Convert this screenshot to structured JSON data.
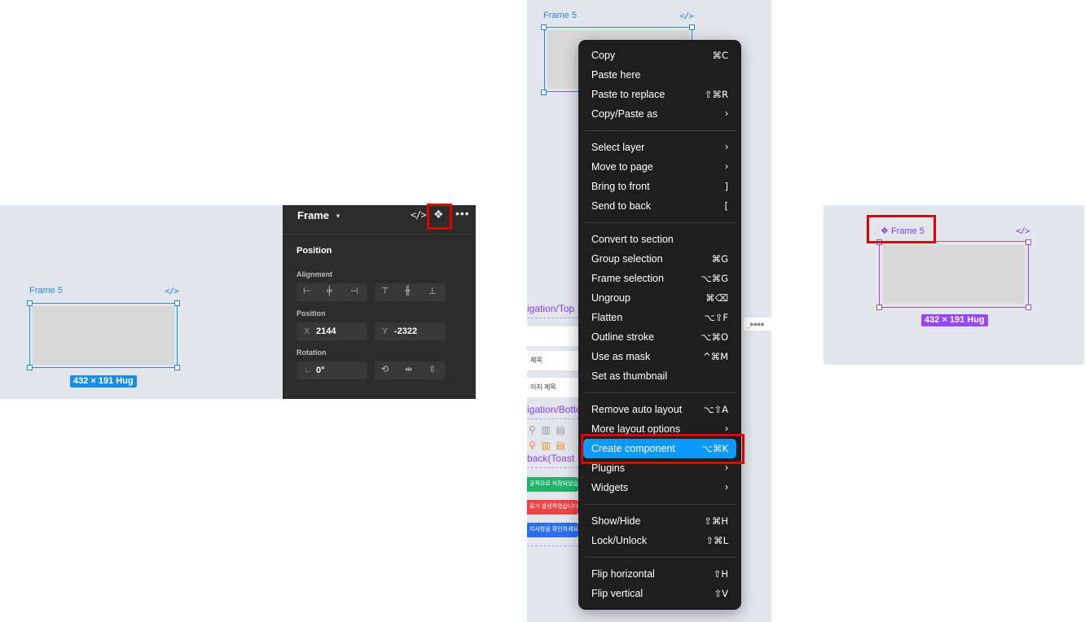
{
  "canvas1": {
    "frame_name": "Frame 5",
    "dimension": "432 × 191 Hug"
  },
  "props_panel": {
    "title": "Frame",
    "sections": {
      "position_header": "Position",
      "alignment_label": "Alignment",
      "position_label": "Position",
      "rotation_label": "Rotation"
    },
    "x_label": "X",
    "x_value": "2144",
    "y_label": "Y",
    "y_value": "-2322",
    "rotation_value": "0°"
  },
  "context_menu": {
    "groups": [
      [
        {
          "label": "Copy",
          "shortcut": "⌘C"
        },
        {
          "label": "Paste here",
          "shortcut": ""
        },
        {
          "label": "Paste to replace",
          "shortcut": "⇧⌘R"
        },
        {
          "label": "Copy/Paste as",
          "arrow": true
        }
      ],
      [
        {
          "label": "Select layer",
          "arrow": true
        },
        {
          "label": "Move to page",
          "arrow": true
        },
        {
          "label": "Bring to front",
          "shortcut": "]"
        },
        {
          "label": "Send to back",
          "shortcut": "["
        }
      ],
      [
        {
          "label": "Convert to section",
          "shortcut": ""
        },
        {
          "label": "Group selection",
          "shortcut": "⌘G"
        },
        {
          "label": "Frame selection",
          "shortcut": "⌥⌘G"
        },
        {
          "label": "Ungroup",
          "shortcut": "⌘⌫"
        },
        {
          "label": "Flatten",
          "shortcut": "⌥⇧F"
        },
        {
          "label": "Outline stroke",
          "shortcut": "⌥⌘O"
        },
        {
          "label": "Use as mask",
          "shortcut": "^⌘M"
        },
        {
          "label": "Set as thumbnail",
          "shortcut": ""
        }
      ],
      [
        {
          "label": "Remove auto layout",
          "shortcut": "⌥⇧A"
        },
        {
          "label": "More layout options",
          "arrow": true
        },
        {
          "label": "Create component",
          "shortcut": "⌥⌘K",
          "active": true
        },
        {
          "label": "Plugins",
          "arrow": true
        },
        {
          "label": "Widgets",
          "arrow": true
        }
      ],
      [
        {
          "label": "Show/Hide",
          "shortcut": "⇧⌘H"
        },
        {
          "label": "Lock/Unlock",
          "shortcut": "⇧⌘L"
        }
      ],
      [
        {
          "label": "Flip horizontal",
          "shortcut": "⇧H"
        },
        {
          "label": "Flip vertical",
          "shortcut": "⇧V"
        }
      ]
    ]
  },
  "canvas3": {
    "frame_name": "Frame 5",
    "bg_texts": {
      "nav_top": "igation/Top",
      "row1": "제목",
      "row2": "이지 제목",
      "nav_bottom": "igation/Botto",
      "feedback": "back(Toast",
      "toast_green": "공적으로 저장되었습니다",
      "toast_red": "류가 발생하였습니다.",
      "toast_blue": "지사항을 확인하세요."
    },
    "ellipsis": "_●●●●"
  },
  "canvas4": {
    "component_name": "Frame 5",
    "dimension": "432 × 191 Hug"
  },
  "colors": {
    "selection_blue": "#1a8ee5",
    "component_purple": "#9747ff",
    "menu_bg": "#1e1e1e",
    "menu_active": "#0d99ff",
    "highlight_red": "#e00000",
    "panel_dark": "#2c2c2c",
    "canvas_bg": "#e4e6ee"
  }
}
